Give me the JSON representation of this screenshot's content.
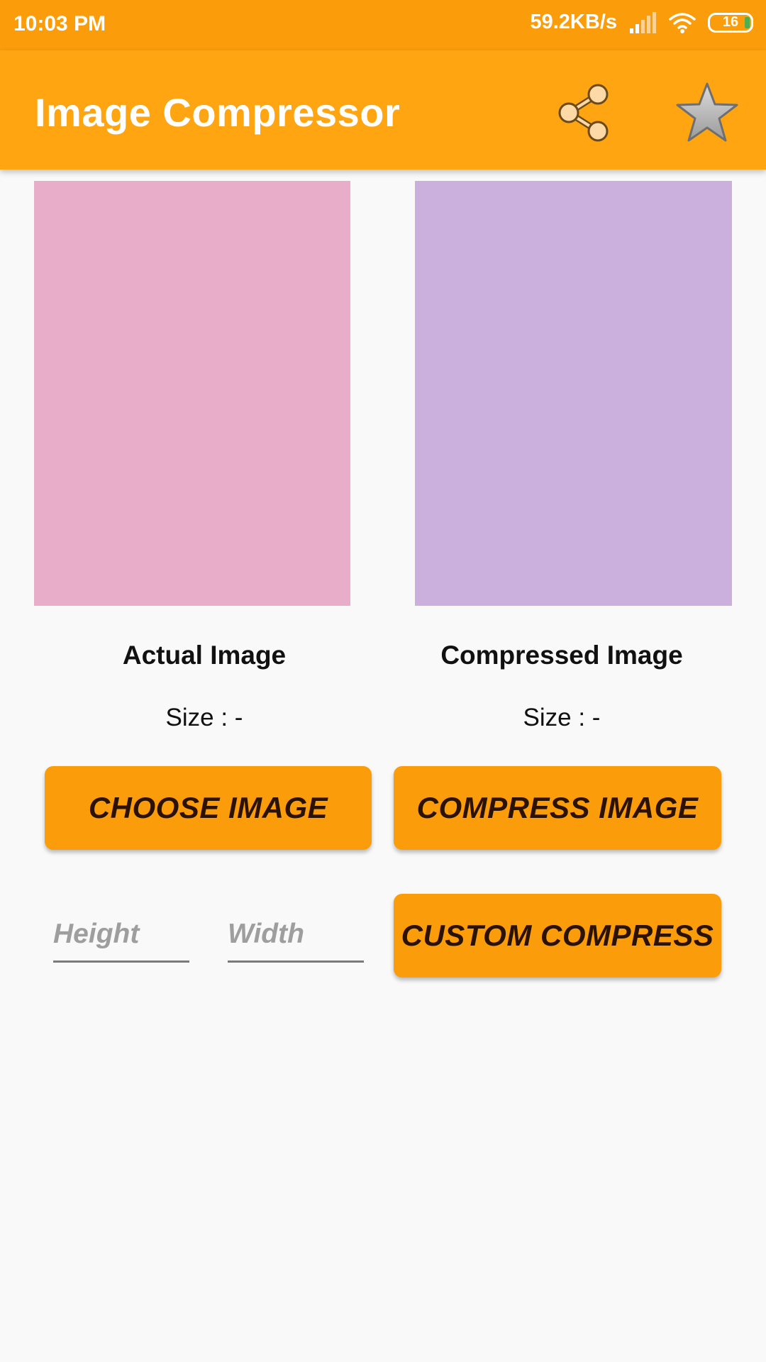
{
  "status_bar": {
    "time": "10:03 PM",
    "network_speed": "59.2KB/s",
    "battery_level": "16",
    "icons": [
      "signal-icon",
      "wifi-icon",
      "battery-icon"
    ]
  },
  "app_bar": {
    "title": "Image Compressor",
    "background_color": "#ffa512",
    "actions": [
      "share-icon",
      "star-icon"
    ]
  },
  "previews": {
    "actual": {
      "caption": "Actual Image",
      "size_text": "Size : -",
      "color": "#e8adc8"
    },
    "compressed": {
      "caption": "Compressed Image",
      "size_text": "Size : -",
      "color": "#cbafdc"
    }
  },
  "buttons": {
    "choose": "CHOOSE IMAGE",
    "compress": "COMPRESS IMAGE",
    "custom": "CUSTOM COMPRESS",
    "color": "#fb9c0a"
  },
  "inputs": {
    "height": {
      "value": "",
      "placeholder": "Height"
    },
    "width": {
      "value": "",
      "placeholder": "Width"
    }
  }
}
